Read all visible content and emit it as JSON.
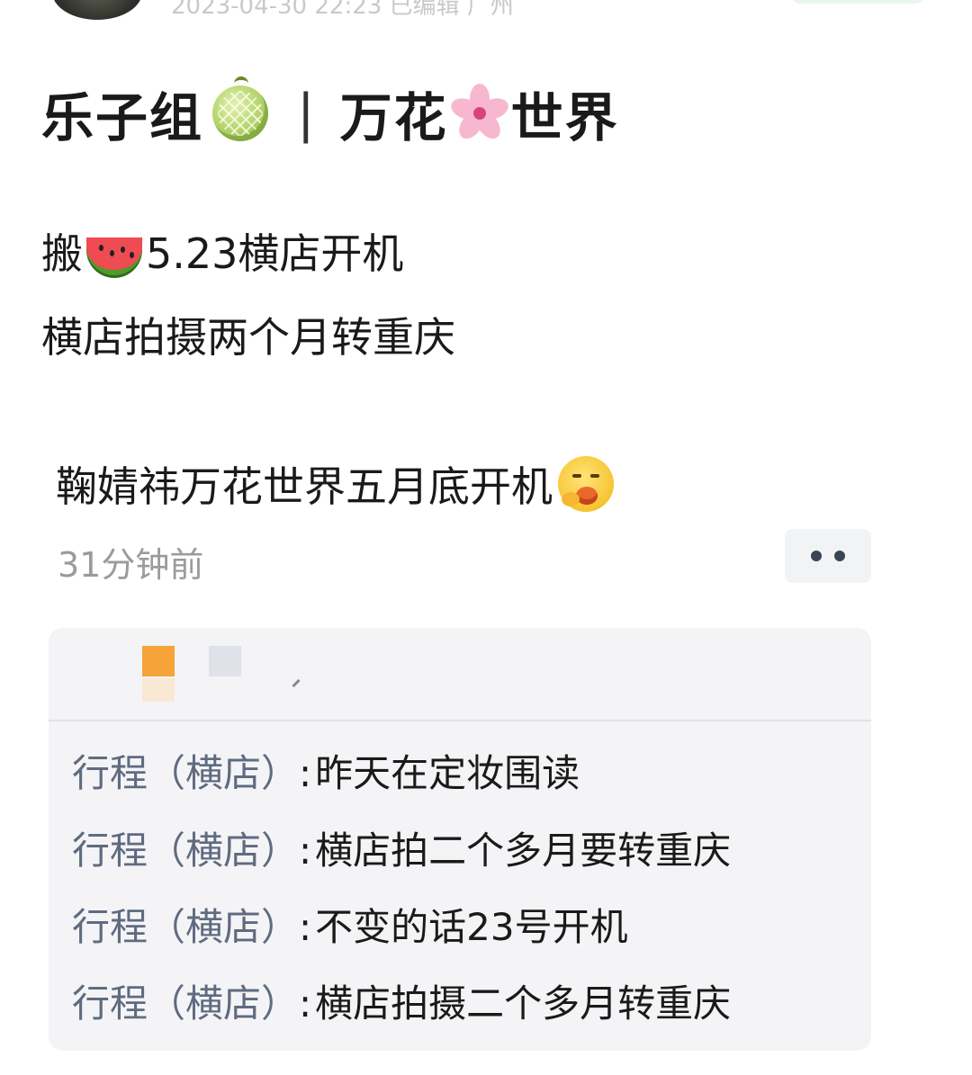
{
  "header": {
    "meta": "2023-04-30 22:23 已编辑 广州"
  },
  "post": {
    "title_left": "乐子组",
    "title_sep": "|",
    "title_mid": "万花",
    "title_right": "世界",
    "line1_prefix": "搬",
    "line1_suffix": "5.23横店开机",
    "line2": "横店拍摄两个月转重庆"
  },
  "quote": {
    "text": "鞠婧祎万花世界五月底开机",
    "time": "31分钟前"
  },
  "card": {
    "rows": [
      {
        "label": "行程（横店）",
        "colon": ":",
        "text": "昨天在定妆围读"
      },
      {
        "label": "行程（横店）",
        "colon": ":",
        "text": "横店拍二个多月要转重庆"
      },
      {
        "label": "行程（横店）",
        "colon": ":",
        "text": "不变的话23号开机"
      },
      {
        "label": "行程（横店）",
        "colon": ":",
        "text": "横店拍摄二个多月转重庆"
      }
    ]
  },
  "icons": {
    "melon": "melon-icon",
    "flower": "cherry-blossom-icon",
    "watermelon": "watermelon-icon",
    "face": "eating-face-icon",
    "more": "more-dots-icon"
  },
  "colors": {
    "label": "#5f6b80",
    "time": "#9b9b9b",
    "card_bg": "#f4f4f6"
  }
}
